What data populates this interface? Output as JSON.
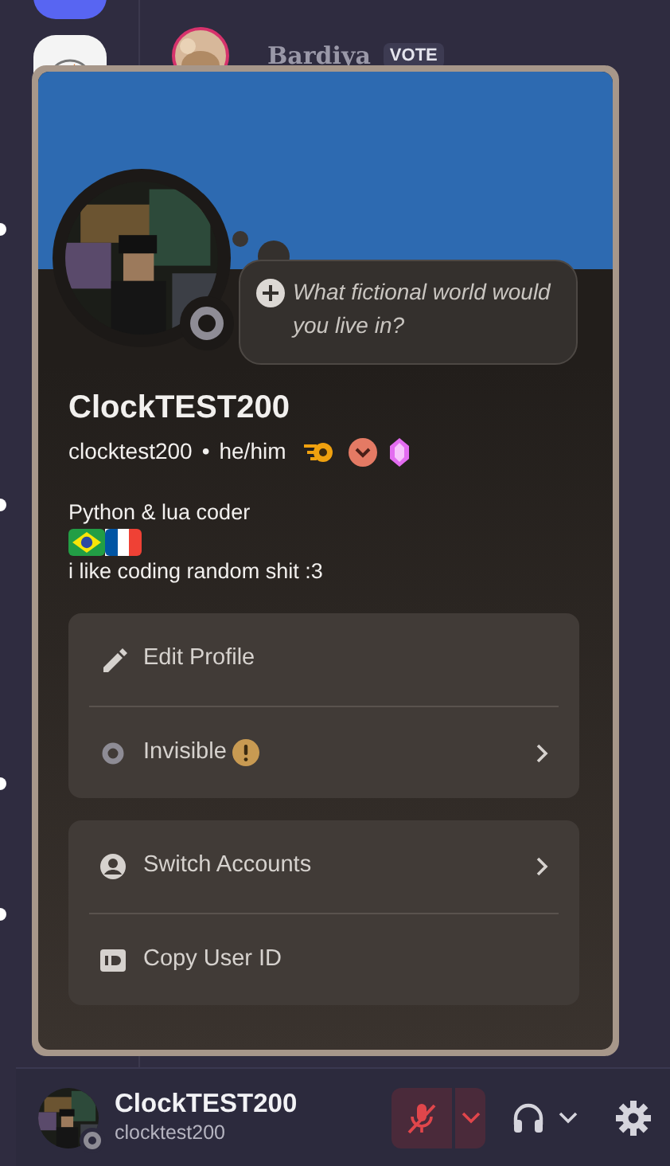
{
  "background_member": {
    "name": "Bardiya",
    "tag": "VOTE"
  },
  "profile": {
    "display_name": "ClockTEST200",
    "username": "clocktest200",
    "separator": "•",
    "pronouns": "he/him",
    "status_prompt": {
      "placeholder": "What fictional world would you live in?"
    },
    "bio": [
      "Python & lua coder",
      "i like coding random shit :3"
    ],
    "menu_groups": [
      [
        {
          "kind": "edit",
          "label": "Edit Profile",
          "arrow": false,
          "warning": false
        },
        {
          "kind": "status",
          "label": "Invisible",
          "arrow": true,
          "warning": true
        }
      ],
      [
        {
          "kind": "switch",
          "label": "Switch Accounts",
          "arrow": true,
          "warning": false
        },
        {
          "kind": "copy",
          "label": "Copy User ID",
          "arrow": false,
          "warning": false
        }
      ]
    ]
  },
  "user_panel": {
    "display_name": "ClockTEST200",
    "username": "clocktest200",
    "mic_muted": true
  }
}
